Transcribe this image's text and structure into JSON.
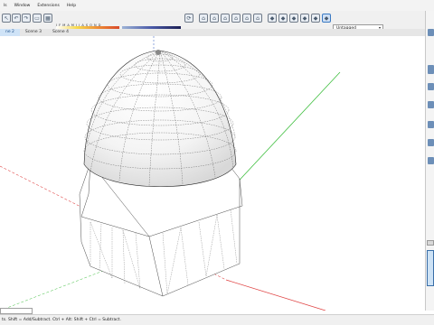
{
  "menu": [
    "ls",
    "Window",
    "Extensions",
    "Help"
  ],
  "sun_months": "J F M A M J J A S O N D",
  "time_start": "06:43 AM",
  "time_end": "04:46 PM",
  "tag_dropdown": "Untagged",
  "scene_tabs": [
    "ne 2",
    "Scene 3",
    "Scene 4"
  ],
  "status_text": "ts. Shift = Add/Subtract. Ctrl + Alt: Shift + Ctrl = Subtract.",
  "axis_colors": {
    "red": "#e04545",
    "green": "#3fbf3f",
    "blue": "#4a6ec8"
  }
}
